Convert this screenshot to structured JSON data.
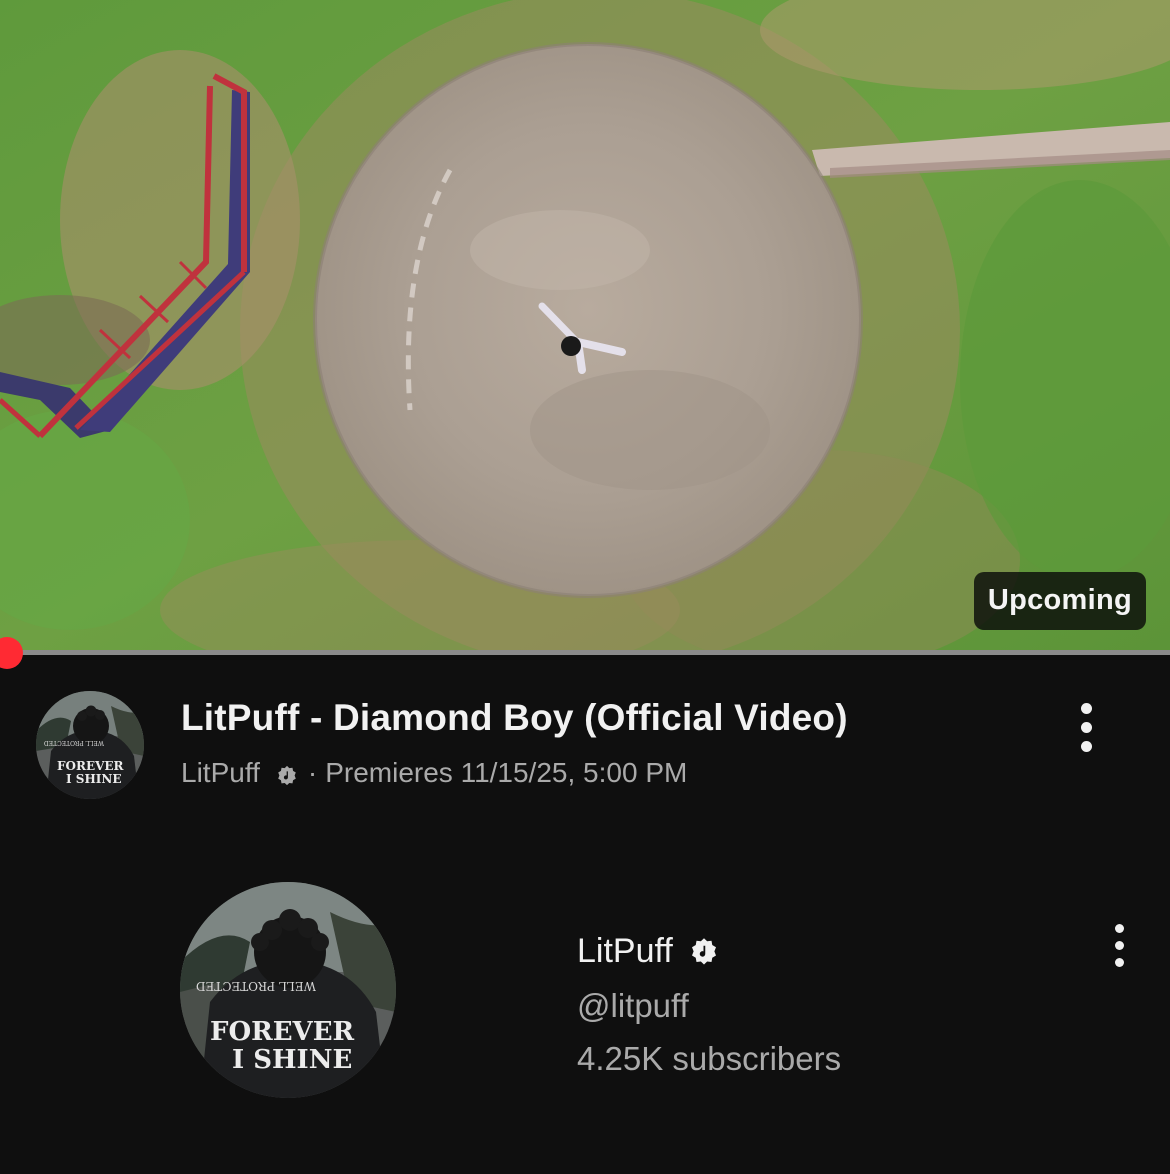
{
  "thumbnail": {
    "badge": "Upcoming"
  },
  "video": {
    "title": "LitPuff - Diamond Boy (Official Video)",
    "channel": "LitPuff",
    "separator": "·",
    "premiere": "Premieres 11/15/25, 5:00 PM"
  },
  "channel_card": {
    "name": "LitPuff",
    "handle": "@litpuff",
    "subscribers": "4.25K subscribers"
  },
  "avatar_art": {
    "jacket_line1": "FOREVER",
    "jacket_line2": "I SHINE",
    "hood_text": "WELL PROTECTED"
  },
  "icons": {
    "verified": "music-note-verified-icon",
    "menu": "more-vert-icon"
  },
  "colors": {
    "background": "#0f0f0f",
    "progress_dot": "#ff2a33",
    "secondary_text": "#aaaaaa"
  }
}
